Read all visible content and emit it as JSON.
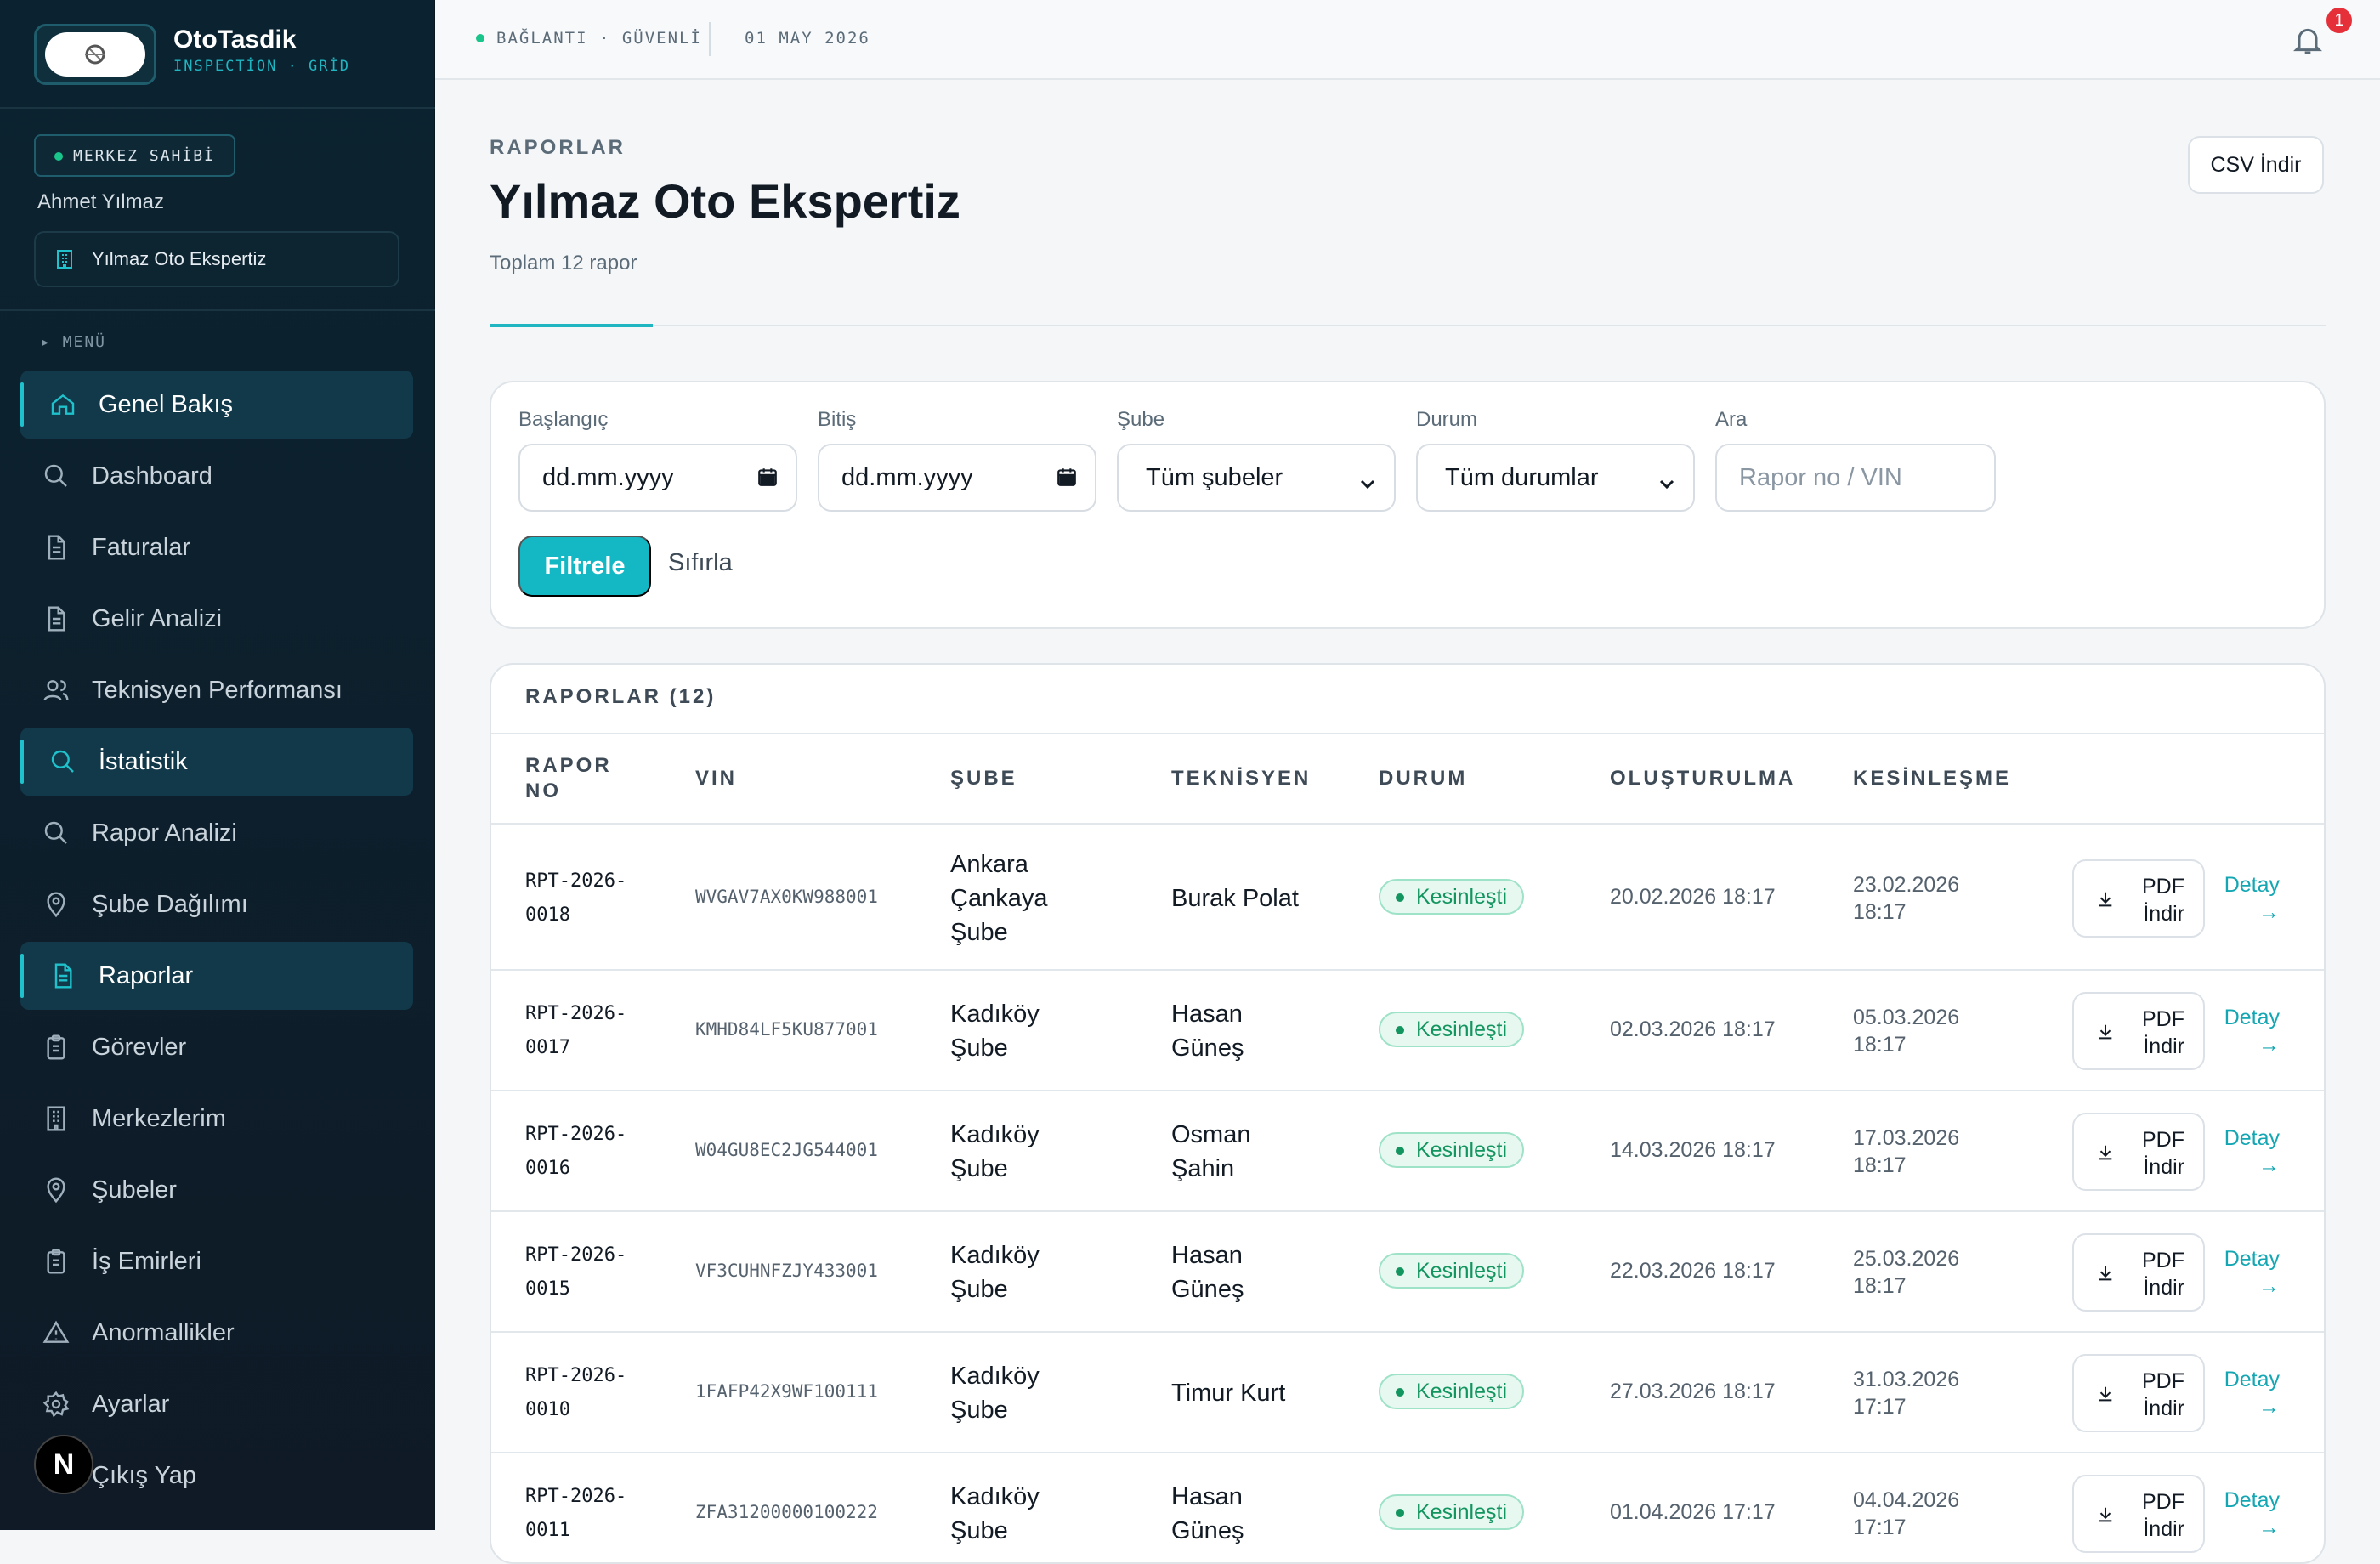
{
  "brand": {
    "name": "OtoTasdik",
    "sub": "INSPECTİON · GRİD"
  },
  "user": {
    "role": "MERKEZ SAHİBİ",
    "name": "Ahmet Yılmaz",
    "center": "Yılmaz Oto Ekspertiz"
  },
  "menu": {
    "label": "▸ MENÜ",
    "items": [
      {
        "label": "Genel Bakış",
        "icon": "home-icon",
        "active": true
      },
      {
        "label": "Dashboard",
        "icon": "search-icon",
        "active": false
      },
      {
        "label": "Faturalar",
        "icon": "document-icon",
        "active": false
      },
      {
        "label": "Gelir Analizi",
        "icon": "document-icon",
        "active": false
      },
      {
        "label": "Teknisyen Performansı",
        "icon": "users-icon",
        "active": false
      },
      {
        "label": "İstatistik",
        "icon": "search-icon",
        "active": true
      },
      {
        "label": "Rapor Analizi",
        "icon": "search-icon",
        "active": false
      },
      {
        "label": "Şube Dağılımı",
        "icon": "map-pin-icon",
        "active": false
      },
      {
        "label": "Raporlar",
        "icon": "document-icon",
        "active": true
      },
      {
        "label": "Görevler",
        "icon": "clipboard-icon",
        "active": false
      },
      {
        "label": "Merkezlerim",
        "icon": "building-icon",
        "active": false
      },
      {
        "label": "Şubeler",
        "icon": "map-pin-icon",
        "active": false
      },
      {
        "label": "İş Emirleri",
        "icon": "clipboard-icon",
        "active": false
      },
      {
        "label": "Anormallikler",
        "icon": "warning-icon",
        "active": false
      },
      {
        "label": "Ayarlar",
        "icon": "gear-icon",
        "active": false
      },
      {
        "label": "Çıkış Yap",
        "icon": "logout-icon",
        "active": false
      }
    ]
  },
  "topbar": {
    "connection": "BAĞLANTI · GÜVENLİ",
    "date": "01 MAY 2026",
    "notifications": "1"
  },
  "page": {
    "eyebrow": "RAPORLAR",
    "title": "Yılmaz Oto Ekspertiz",
    "subtitle": "Toplam 12 rapor",
    "csv_label": "CSV İndir"
  },
  "filters": {
    "start_label": "Başlangıç",
    "start_value": "dd.mm.yyyy",
    "end_label": "Bitiş",
    "end_value": "dd.mm.yyyy",
    "branch_label": "Şube",
    "branch_value": "Tüm şubeler",
    "status_label": "Durum",
    "status_value": "Tüm durumlar",
    "search_label": "Ara",
    "search_placeholder": "Rapor no / VIN",
    "apply_label": "Filtrele",
    "reset_label": "Sıfırla"
  },
  "table": {
    "title": "RAPORLAR (12)",
    "headers": {
      "no_1": "RAPOR",
      "no_2": "NO",
      "vin": "VIN",
      "branch": "ŞUBE",
      "tech": "TEKNİSYEN",
      "status": "DURUM",
      "created": "OLUŞTURULMA",
      "finalized": "KESİNLEŞME"
    },
    "pdf_1": "PDF",
    "pdf_2": "İndir",
    "detail": "Detay",
    "detail_arrow": "→",
    "rows": [
      {
        "no_1": "RPT-2026-",
        "no_2": "0018",
        "vin": "WVGAV7AX0KW988001",
        "branch": [
          "Ankara",
          "Çankaya",
          "Şube"
        ],
        "tech": [
          "Burak Polat"
        ],
        "status": "Kesinleşti",
        "created": "20.02.2026 18:17",
        "fin_1": "23.02.2026",
        "fin_2": "18:17"
      },
      {
        "no_1": "RPT-2026-",
        "no_2": "0017",
        "vin": "KMHD84LF5KU877001",
        "branch": [
          "Kadıköy",
          "Şube"
        ],
        "tech": [
          "Hasan",
          "Güneş"
        ],
        "status": "Kesinleşti",
        "created": "02.03.2026 18:17",
        "fin_1": "05.03.2026",
        "fin_2": "18:17"
      },
      {
        "no_1": "RPT-2026-",
        "no_2": "0016",
        "vin": "W04GU8EC2JG544001",
        "branch": [
          "Kadıköy",
          "Şube"
        ],
        "tech": [
          "Osman",
          "Şahin"
        ],
        "status": "Kesinleşti",
        "created": "14.03.2026 18:17",
        "fin_1": "17.03.2026",
        "fin_2": "18:17"
      },
      {
        "no_1": "RPT-2026-",
        "no_2": "0015",
        "vin": "VF3CUHNFZJY433001",
        "branch": [
          "Kadıköy",
          "Şube"
        ],
        "tech": [
          "Hasan",
          "Güneş"
        ],
        "status": "Kesinleşti",
        "created": "22.03.2026 18:17",
        "fin_1": "25.03.2026",
        "fin_2": "18:17"
      },
      {
        "no_1": "RPT-2026-",
        "no_2": "0010",
        "vin": "1FAFP42X9WF100111",
        "branch": [
          "Kadıköy",
          "Şube"
        ],
        "tech": [
          "Timur Kurt"
        ],
        "status": "Kesinleşti",
        "created": "27.03.2026 18:17",
        "fin_1": "31.03.2026",
        "fin_2": "17:17"
      },
      {
        "no_1": "RPT-2026-",
        "no_2": "0011",
        "vin": "ZFA31200000100222",
        "branch": [
          "Kadıköy",
          "Şube"
        ],
        "tech": [
          "Hasan",
          "Güneş"
        ],
        "status": "Kesinleşti",
        "created": "01.04.2026 17:17",
        "fin_1": "04.04.2026",
        "fin_2": "17:17"
      }
    ]
  },
  "colors": {
    "accent": "#14b8c4",
    "sidebar": "#0d1f2c",
    "success": "#13955f",
    "alert": "#e5303a"
  }
}
